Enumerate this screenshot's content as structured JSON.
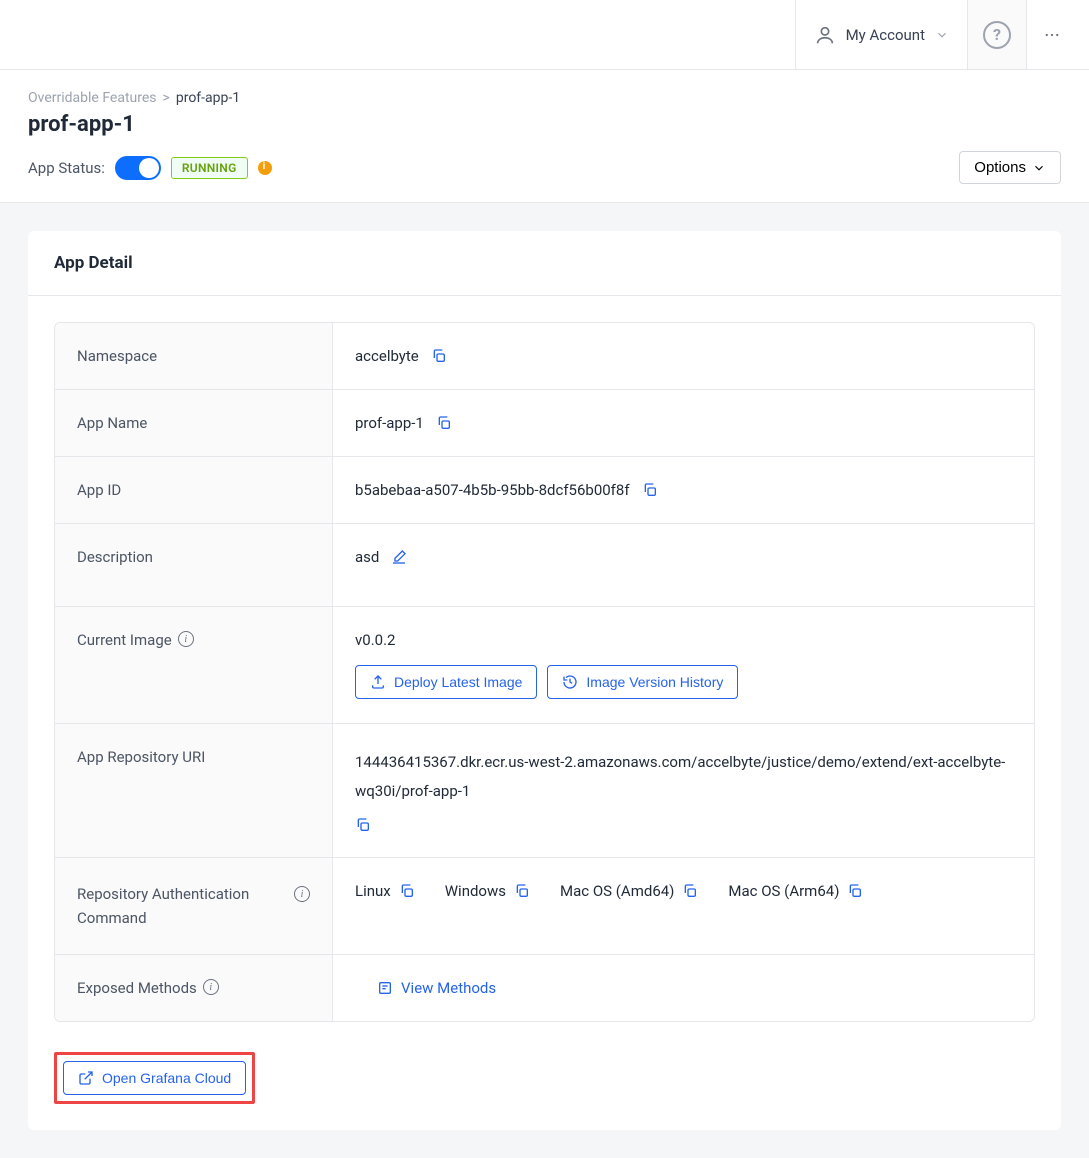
{
  "topbar": {
    "account_label": "My Account"
  },
  "breadcrumb": {
    "parent": "Overridable Features",
    "separator": ">",
    "current": "prof-app-1"
  },
  "page_title": "prof-app-1",
  "status": {
    "label": "App Status:",
    "badge": "RUNNING"
  },
  "options_label": "Options",
  "card": {
    "title": "App Detail"
  },
  "detail": {
    "namespace_label": "Namespace",
    "namespace_value": "accelbyte",
    "appname_label": "App Name",
    "appname_value": "prof-app-1",
    "appid_label": "App ID",
    "appid_value": "b5abebaa-a507-4b5b-95bb-8dcf56b00f8f",
    "description_label": "Description",
    "description_value": "asd",
    "currentimage_label": "Current Image",
    "currentimage_value": "v0.0.2",
    "deploy_btn": "Deploy Latest Image",
    "history_btn": "Image Version History",
    "repouri_label": "App Repository URI",
    "repouri_value": "144436415367.dkr.ecr.us-west-2.amazonaws.com/accelbyte/justice/demo/extend/ext-accelbyte-wq30i/prof-app-1",
    "repoauth_label": "Repository Authentication Command",
    "os_linux": "Linux",
    "os_windows": "Windows",
    "os_mac_amd": "Mac OS (Amd64)",
    "os_mac_arm": "Mac OS (Arm64)",
    "exposed_label": "Exposed Methods",
    "view_methods": "View Methods"
  },
  "grafana_label": "Open Grafana Cloud"
}
